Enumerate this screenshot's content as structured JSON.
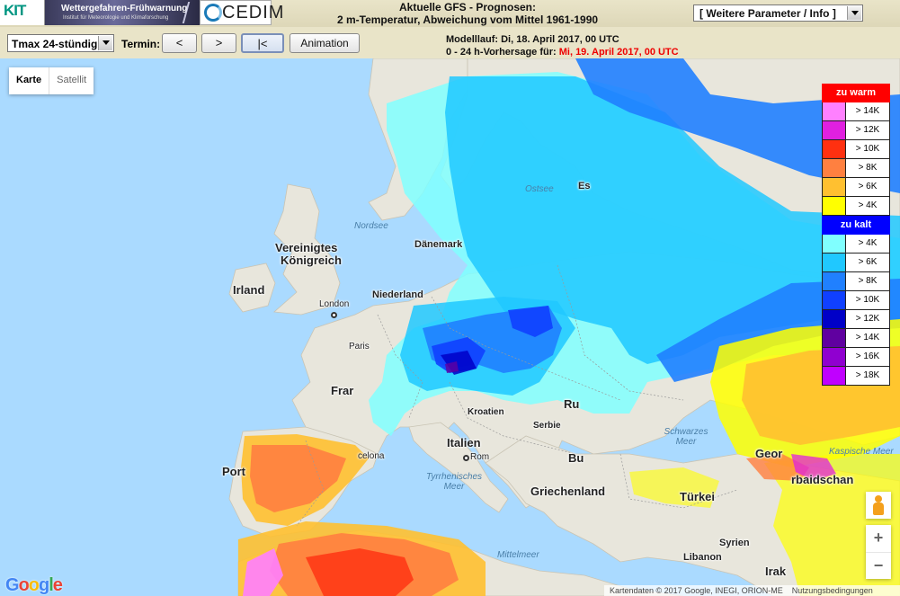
{
  "header": {
    "kit_logo_text": "KIT",
    "banner_title": "Wettergefahren-Frühwarnung",
    "banner_subtitle": "Institut für Meteorologie und Klimaforschung",
    "cedim_logo_text": "CEDIM",
    "title_line1": "Aktuelle GFS - Prognosen:",
    "title_line2": "2 m-Temperatur, Abweichung vom Mittel 1961-1990",
    "param_select_value": "[ Weitere Parameter / Info ]"
  },
  "toolbar": {
    "mode_select_value": "Tmax 24-stündig",
    "termin_label": "Termin:",
    "prev_label": "<",
    "next_label": ">",
    "first_label": "|<",
    "animation_label": "Animation",
    "run_label": "Modelllauf: Di, 18. April 2017, 00 UTC",
    "forecast_label": "0 - 24 h-Vorhersage für:",
    "forecast_date": "Mi, 19. April 2017, 00 UTC"
  },
  "map": {
    "maptype_map": "Karte",
    "maptype_satellite": "Satellit",
    "labels": {
      "uk": "Vereinigtes",
      "uk2": "Königreich",
      "ireland": "Irland",
      "london": "London",
      "paris": "Paris",
      "france": "Frar",
      "netherlands": "Niederland",
      "denmark": "Dänemark",
      "estonia": "Es",
      "croatia": "Kroatien",
      "serbia": "Serbie",
      "romania": "Ru",
      "bulgaria": "Bu",
      "italy": "Italien",
      "rome": "Rom",
      "greece": "Griechenland",
      "turkey": "Türkei",
      "portugal": "Port",
      "barcelona": "celona",
      "syria": "Syrien",
      "lebanon": "Libanon",
      "iraq": "Irak",
      "georgia": "Geor",
      "azerbaijan": "rbaidschan",
      "nordsee": "Nordsee",
      "ostsee": "Ostsee",
      "schwarzes_meer": "Schwarzes Meer",
      "tyrrhenisches_meer": "Tyrrhenisches Meer",
      "mittelmeer": "Mittelmeer",
      "kaspisches_meer": "Kaspische Meer"
    },
    "google_logo": "Google",
    "attribution": "Kartendaten © 2017 Google, INEGI, ORION-ME",
    "terms": "Nutzungsbedingungen",
    "zoom_in": "+",
    "zoom_out": "−"
  },
  "legend": {
    "warm_title": "zu warm",
    "warm_color": "#ff0000",
    "cold_title": "zu kalt",
    "cold_color": "#0000ff",
    "warm_rows": [
      {
        "label": "> 14K",
        "color": "#ff80ff"
      },
      {
        "label": "> 12K",
        "color": "#e020e0"
      },
      {
        "label": "> 10K",
        "color": "#ff3010"
      },
      {
        "label": "> 8K",
        "color": "#ff8040"
      },
      {
        "label": "> 6K",
        "color": "#ffc030"
      },
      {
        "label": "> 4K",
        "color": "#ffff00"
      }
    ],
    "cold_rows": [
      {
        "label": "> 4K",
        "color": "#80ffff"
      },
      {
        "label": "> 6K",
        "color": "#20c8ff"
      },
      {
        "label": "> 8K",
        "color": "#2080ff"
      },
      {
        "label": "> 10K",
        "color": "#1040ff"
      },
      {
        "label": "> 12K",
        "color": "#0000c8"
      },
      {
        "label": "> 14K",
        "color": "#6000a0"
      },
      {
        "label": "> 16K",
        "color": "#9000d0"
      },
      {
        "label": "> 18K",
        "color": "#c000ff"
      }
    ]
  }
}
